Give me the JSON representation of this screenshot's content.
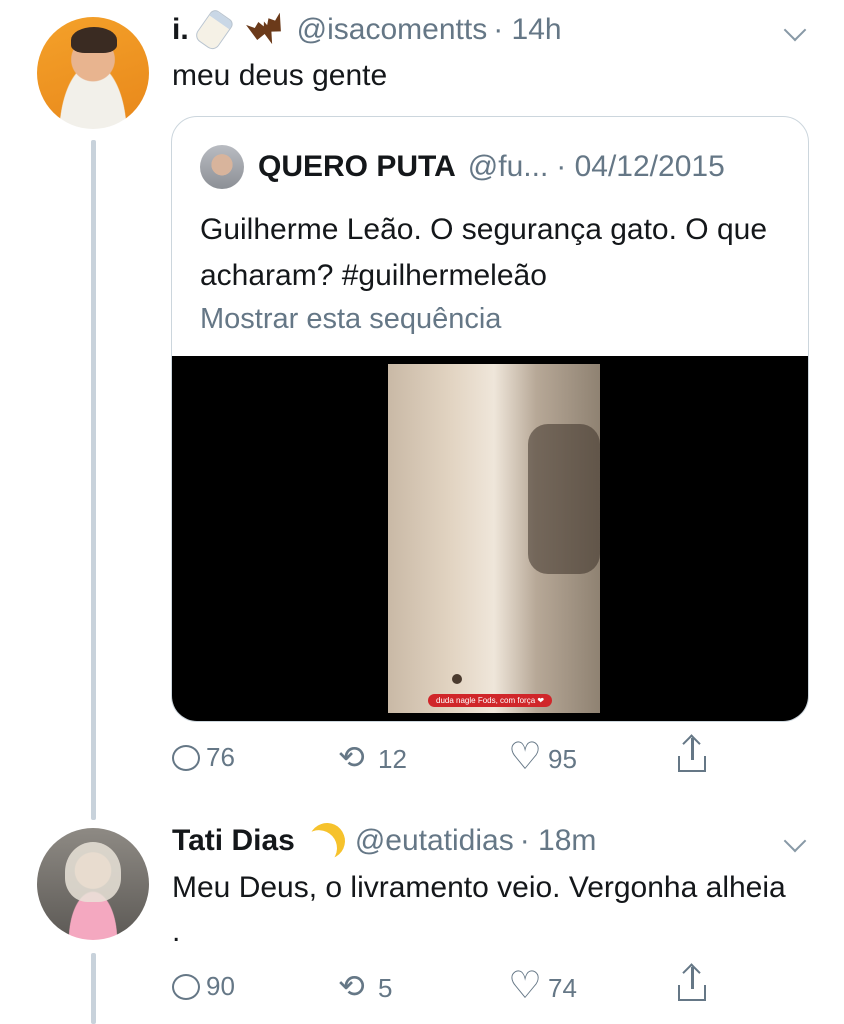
{
  "tweet1": {
    "name": "i.",
    "handle": "@isacomentts",
    "time": "· 14h",
    "text": "meu deus gente",
    "quote": {
      "name": "QUERO PUTA",
      "handle": "@fu...",
      "date": "· 04/12/2015",
      "text": "Guilherme Leão. O segurança gato. O que acharam? #guilhermeleão",
      "show_thread": "Mostrar esta sequência",
      "video_caption": "duda nagle Fods, com força ❤"
    },
    "actions": {
      "replies": "76",
      "retweets": "12",
      "likes": "95"
    }
  },
  "tweet2": {
    "name": "Tati Dias",
    "handle": "@eutatidias",
    "time": "· 18m",
    "text": "Meu Deus, o livramento veio. Vergonha alheia .",
    "actions": {
      "replies": "90",
      "retweets": "5",
      "likes": "74"
    }
  },
  "icons": [
    "baby-bottle-icon",
    "bat-icon",
    "crescent-moon-icon",
    "reply-icon",
    "retweet-icon",
    "like-icon",
    "share-icon",
    "chevron-down-icon"
  ],
  "colors": {
    "secondary_text": "#657786",
    "thread_line": "#c8d2db",
    "border": "#ccd6dd"
  }
}
